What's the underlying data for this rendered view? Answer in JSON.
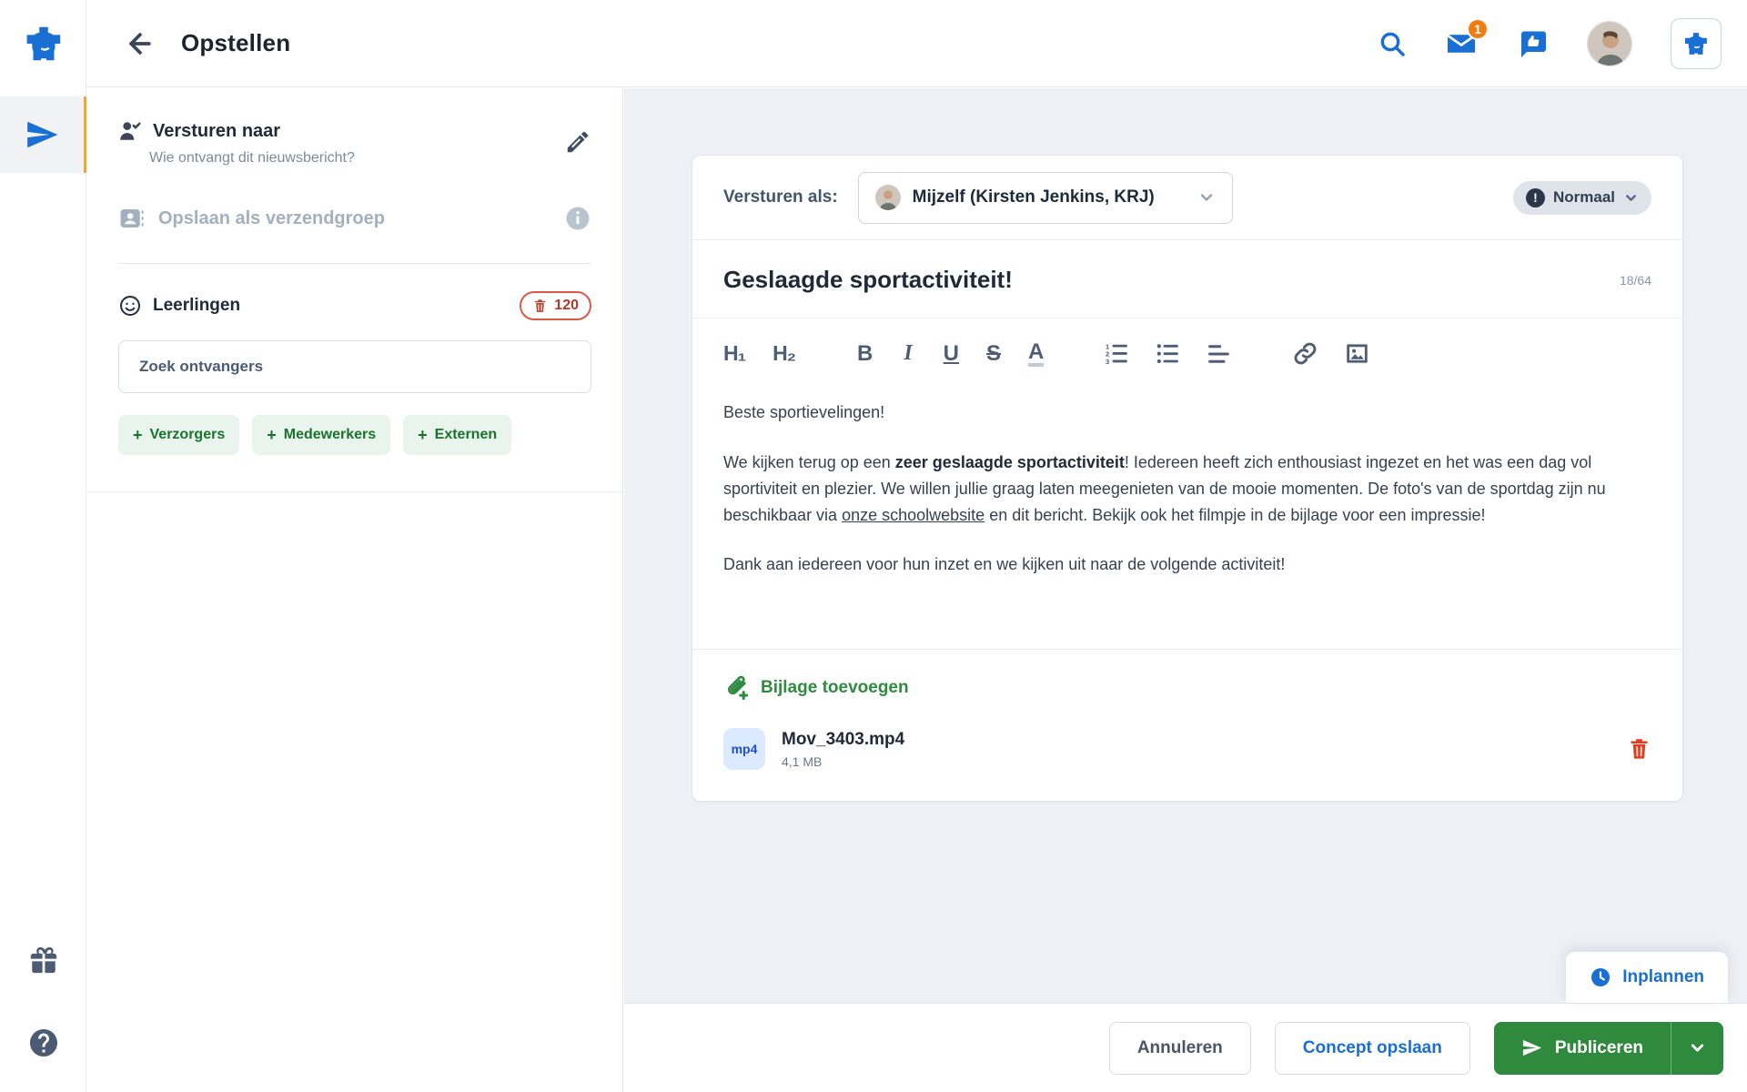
{
  "header": {
    "title": "Opstellen",
    "mail_badge": "1"
  },
  "sidebar": {
    "send_to_title": "Versturen naar",
    "send_to_subtitle": "Wie ontvangt dit nieuwsbericht?",
    "save_group_label": "Opslaan als verzendgroep",
    "group_label": "Leerlingen",
    "group_count": "120",
    "search_placeholder": "Zoek ontvangers",
    "add_buttons": [
      "Verzorgers",
      "Medewerkers",
      "Externen"
    ]
  },
  "compose": {
    "send_as_label": "Versturen als:",
    "send_as_value": "Mijzelf (Kirsten Jenkins, KRJ)",
    "priority_label": "Normaal",
    "priority_icon_glyph": "!",
    "subject": "Geslaagde sportactiviteit!",
    "char_counter": "18/64",
    "toolbar": {
      "h1": "H₁",
      "h2": "H₂",
      "bold": "B",
      "italic": "I",
      "underline": "U",
      "strike": "S",
      "color": "A"
    },
    "body": {
      "p1": "Beste sportievelingen!",
      "p2_pre": "We kijken terug op een ",
      "p2_bold": "zeer geslaagde sportactiviteit",
      "p2_mid": "! Iedereen heeft zich enthousiast ingezet en het was een dag vol sportiviteit en plezier. We willen jullie graag laten meegenieten van de mooie momenten. De foto's van de sportdag zijn nu beschikbaar via ",
      "p2_link": "onze schoolwebsite",
      "p2_post": " en dit bericht. Bekijk ook het filmpje in de bijlage voor een impressie!",
      "p3": "Dank aan iedereen voor hun inzet en we kijken uit naar de volgende activiteit!"
    },
    "attachment": {
      "add_label": "Bijlage toevoegen",
      "file_type": "mp4",
      "file_name": "Mov_3403.mp4",
      "file_size": "4,1 MB"
    }
  },
  "footer": {
    "schedule_label": "Inplannen",
    "cancel_label": "Annuleren",
    "save_draft_label": "Concept opslaan",
    "publish_label": "Publiceren"
  },
  "colors": {
    "brand_blue": "#1a6fd4",
    "accent_orange": "#f0a92e",
    "badge_orange": "#f07c12",
    "danger_red": "#e05744",
    "green_dark": "#2f8a3d",
    "green_light_bg": "#e9f5ec",
    "main_bg": "#edf0f4"
  }
}
